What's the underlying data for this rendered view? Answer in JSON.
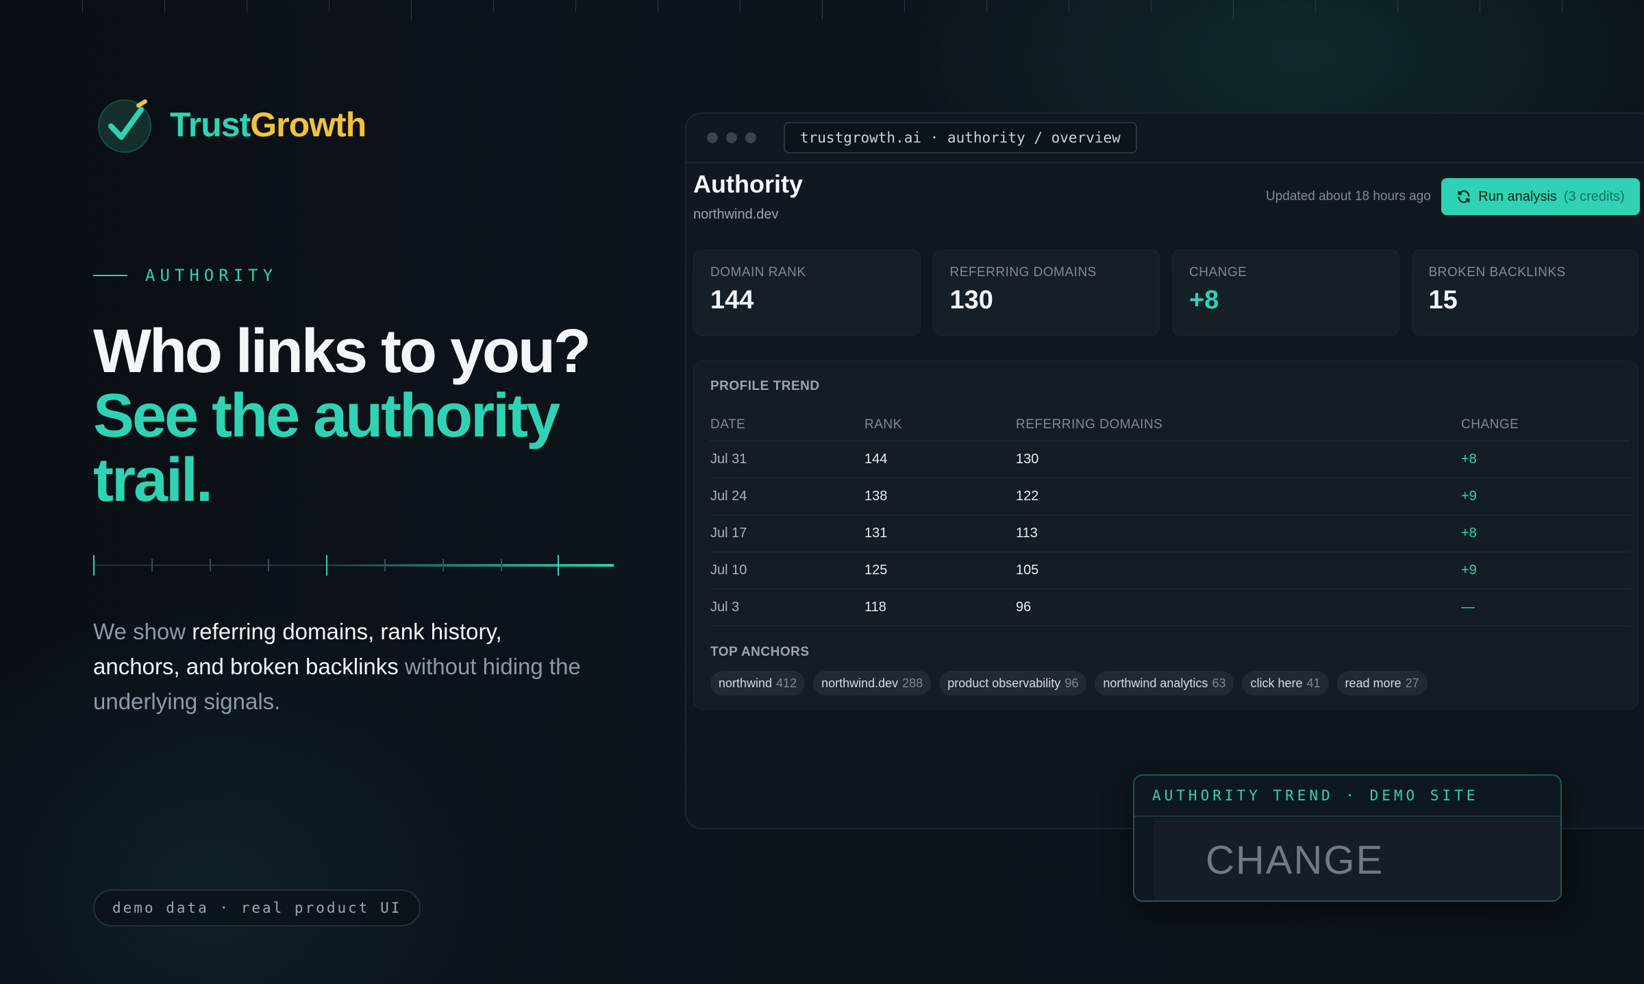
{
  "brand": {
    "name_part1": "Trust",
    "name_part2": "Growth",
    "accent": "#2fd3b3",
    "accent2": "#f2c23a",
    "logo_icon": "check-circle-icon"
  },
  "hero": {
    "eyebrow": "AUTHORITY",
    "headline_line1": "Who links to you?",
    "headline_line2": "See the authority trail.",
    "lede_part1": "We show ",
    "lede_strong": "referring domains, rank history, anchors, and broken backlinks",
    "lede_part2": " without hiding the underlying signals."
  },
  "footer_pill": "demo data · real product UI",
  "window": {
    "url": "trustgrowth.ai · authority / overview",
    "title": "Authority",
    "subtitle": "northwind.dev",
    "updated": "Updated about 18 hours ago",
    "run_button": {
      "label": "Run analysis",
      "credits": "(3 credits)",
      "icon": "refresh-icon"
    },
    "stats": [
      {
        "label": "DOMAIN RANK",
        "value": "144"
      },
      {
        "label": "REFERRING DOMAINS",
        "value": "130"
      },
      {
        "label": "CHANGE",
        "value": "+8"
      },
      {
        "label": "BROKEN BACKLINKS",
        "value": "15"
      }
    ],
    "profile_trend": {
      "heading": "PROFILE TREND",
      "columns": [
        "DATE",
        "RANK",
        "REFERRING DOMAINS",
        "CHANGE"
      ],
      "rows": [
        {
          "date": "Jul 31",
          "rank": "144",
          "ref": "130",
          "change": "+8"
        },
        {
          "date": "Jul 24",
          "rank": "138",
          "ref": "122",
          "change": "+9"
        },
        {
          "date": "Jul 17",
          "rank": "131",
          "ref": "113",
          "change": "+8"
        },
        {
          "date": "Jul 10",
          "rank": "125",
          "ref": "105",
          "change": "+9"
        },
        {
          "date": "Jul 3",
          "rank": "118",
          "ref": "96",
          "change": "—"
        }
      ]
    },
    "top_anchors": {
      "heading": "TOP ANCHORS",
      "items": [
        {
          "text": "northwind",
          "count": "412"
        },
        {
          "text": "northwind.dev",
          "count": "288"
        },
        {
          "text": "product observability",
          "count": "96"
        },
        {
          "text": "northwind analytics",
          "count": "63"
        },
        {
          "text": "click here",
          "count": "41"
        },
        {
          "text": "read more",
          "count": "27"
        }
      ]
    }
  },
  "trend_card": {
    "heading": "AUTHORITY TREND · DEMO SITE",
    "big_label": "CHANGE"
  }
}
